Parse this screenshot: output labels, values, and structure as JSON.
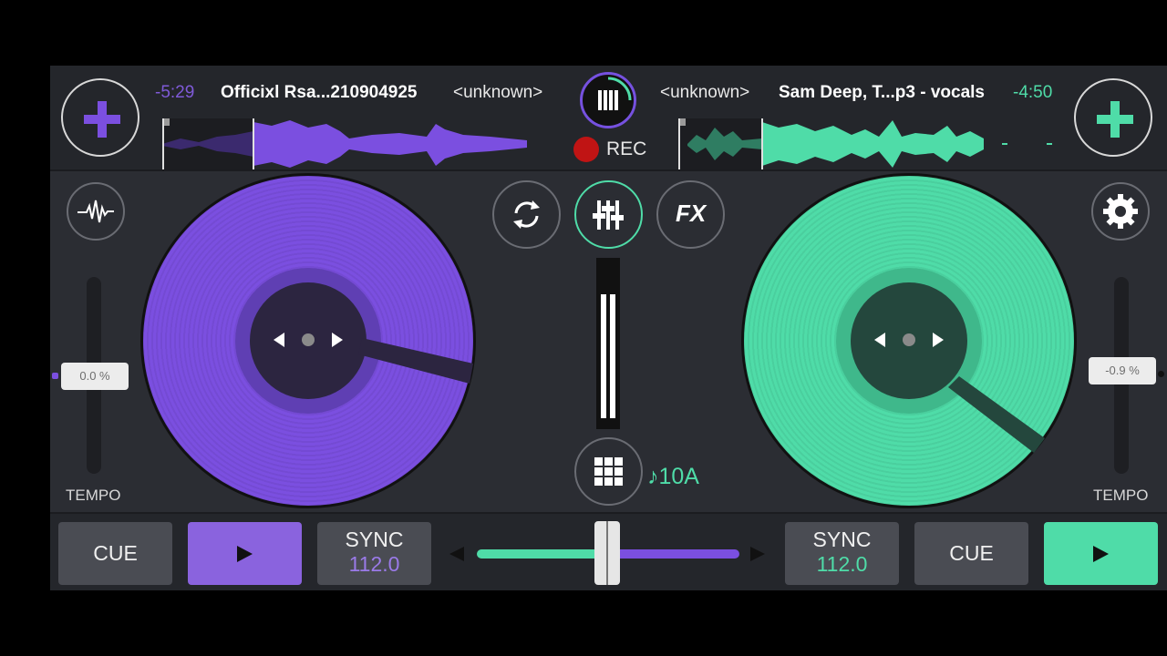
{
  "deck_a": {
    "remaining_time": "-5:29",
    "title": "Officixl Rsa...210904925",
    "artist": "<unknown>",
    "color": "#7b4fe0",
    "tempo_value": "0.0 %",
    "tempo_label": "TEMPO",
    "cue_label": "CUE",
    "play_icon": "play-icon",
    "sync_label": "SYNC",
    "bpm": "112.0"
  },
  "deck_b": {
    "remaining_time": "-4:50",
    "title": "Sam Deep, T...p3 - vocals",
    "artist": "<unknown>",
    "color": "#4fdca8",
    "tempo_value": "-0.9 %",
    "tempo_label": "TEMPO",
    "cue_label": "CUE",
    "play_icon": "play-icon",
    "sync_label": "SYNC",
    "bpm": "112.0"
  },
  "record": {
    "label": "REC"
  },
  "center": {
    "loop_icon": "loop-icon",
    "mixer_icon": "mixer-sliders-icon",
    "fx_label": "FX",
    "grid_icon": "grid-icon",
    "key": "♪10A"
  },
  "crossfader": {
    "position": 0.5
  },
  "icons": {
    "waveform": "waveform-icon",
    "settings": "gear-icon",
    "add": "plus-icon"
  }
}
